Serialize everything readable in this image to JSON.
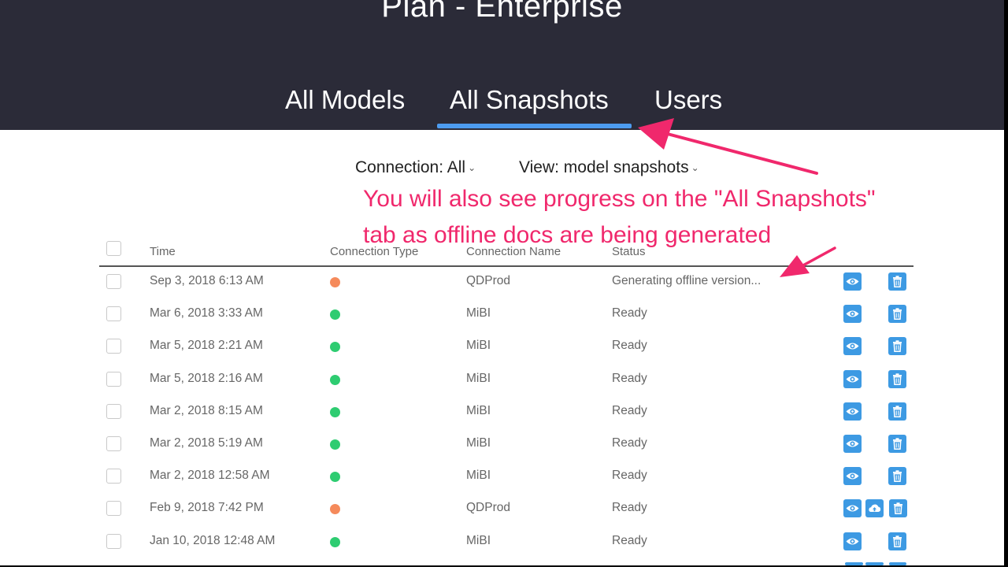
{
  "app": {
    "title": "Plan - Enterprise"
  },
  "tabs": [
    {
      "label": "All Models",
      "active": false
    },
    {
      "label": "All Snapshots",
      "active": true
    },
    {
      "label": "Users",
      "active": false
    }
  ],
  "filters": {
    "connection": "Connection: All",
    "view": "View: model snapshots"
  },
  "annotation": {
    "line1": "You will also see progress on the \"All Snapshots\"",
    "line2": "tab as offline docs are being generated",
    "color": "#f0286c"
  },
  "table": {
    "columns": [
      "Time",
      "Connection Type",
      "Connection Name",
      "Status"
    ],
    "rows": [
      {
        "time": "Sep 3, 2018 6:13 AM",
        "type_color": "#f58a5b",
        "name": "QDProd",
        "status": "Generating offline version...",
        "actions": [
          "eye-icon",
          "trash-icon"
        ]
      },
      {
        "time": "Mar 6, 2018 3:33 AM",
        "type_color": "#2ecc71",
        "name": "MiBI",
        "status": "Ready",
        "actions": [
          "eye-icon",
          "trash-icon"
        ]
      },
      {
        "time": "Mar 5, 2018 2:21 AM",
        "type_color": "#2ecc71",
        "name": "MiBI",
        "status": "Ready",
        "actions": [
          "eye-icon",
          "trash-icon"
        ]
      },
      {
        "time": "Mar 5, 2018 2:16 AM",
        "type_color": "#2ecc71",
        "name": "MiBI",
        "status": "Ready",
        "actions": [
          "eye-icon",
          "trash-icon"
        ]
      },
      {
        "time": "Mar 2, 2018 8:15 AM",
        "type_color": "#2ecc71",
        "name": "MiBI",
        "status": "Ready",
        "actions": [
          "eye-icon",
          "trash-icon"
        ]
      },
      {
        "time": "Mar 2, 2018 5:19 AM",
        "type_color": "#2ecc71",
        "name": "MiBI",
        "status": "Ready",
        "actions": [
          "eye-icon",
          "trash-icon"
        ]
      },
      {
        "time": "Mar 2, 2018 12:58 AM",
        "type_color": "#2ecc71",
        "name": "MiBI",
        "status": "Ready",
        "actions": [
          "eye-icon",
          "trash-icon"
        ]
      },
      {
        "time": "Feb 9, 2018 7:42 PM",
        "type_color": "#f58a5b",
        "name": "QDProd",
        "status": "Ready",
        "actions": [
          "eye-icon",
          "cloud-upload-icon",
          "trash-icon"
        ]
      },
      {
        "time": "Jan 10, 2018 12:48 AM",
        "type_color": "#2ecc71",
        "name": "MiBI",
        "status": "Ready",
        "actions": [
          "eye-icon",
          "trash-icon"
        ]
      }
    ]
  },
  "colors": {
    "header_bg": "#2b2b38",
    "accent": "#4d9cf0",
    "action_button": "#3d9ae3"
  }
}
